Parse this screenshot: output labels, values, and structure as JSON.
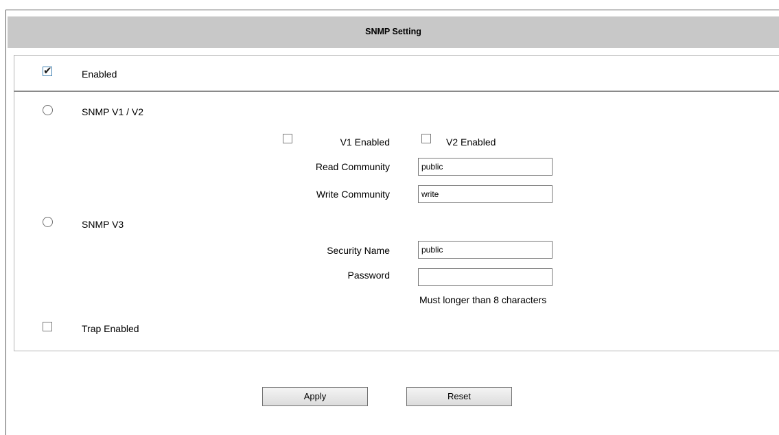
{
  "header": {
    "title": "SNMP Setting"
  },
  "enabled": {
    "label": "Enabled",
    "checked": true
  },
  "snmp_v1v2": {
    "label": "SNMP V1 / V2",
    "selected": false,
    "v1_enabled_label": "V1 Enabled",
    "v1_enabled": false,
    "v2_enabled_label": "V2 Enabled",
    "v2_enabled": false,
    "read_community_label": "Read Community",
    "read_community_value": "public",
    "write_community_label": "Write Community",
    "write_community_value": "write"
  },
  "snmp_v3": {
    "label": "SNMP V3",
    "selected": false,
    "security_name_label": "Security Name",
    "security_name_value": "public",
    "password_label": "Password",
    "password_value": "",
    "password_hint": "Must longer than 8 characters"
  },
  "trap": {
    "label": "Trap Enabled",
    "checked": false
  },
  "buttons": {
    "apply": "Apply",
    "reset": "Reset"
  }
}
